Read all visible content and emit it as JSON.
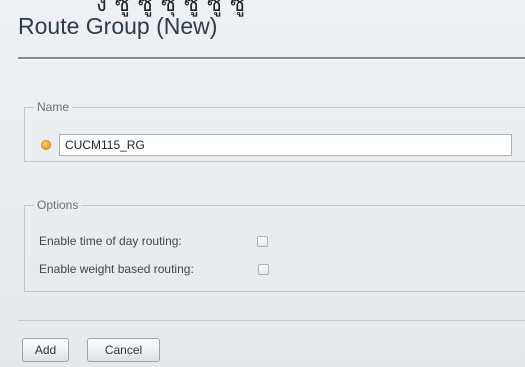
{
  "page": {
    "clipped_header": "ง ซู ซู ซุ ซู๊ ซู่ ซู",
    "title": "Route Group (New)"
  },
  "name_group": {
    "legend": "Name",
    "input_value": "CUCM115_RG"
  },
  "options_group": {
    "legend": "Options",
    "time_of_day_label": "Enable time of day routing:",
    "weight_based_label": "Enable weight based routing:",
    "time_of_day_checked": false,
    "weight_based_checked": false
  },
  "buttons": {
    "add_label": "Add",
    "cancel_label": "Cancel"
  },
  "colors": {
    "required_indicator": "#f2a31b"
  },
  "icons": {
    "required": "required-field-icon"
  }
}
